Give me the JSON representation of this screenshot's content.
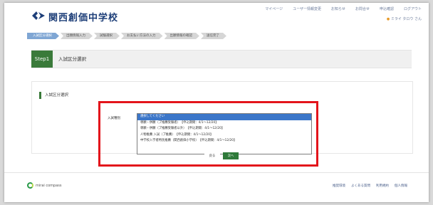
{
  "header": {
    "school_name": "関西創価中学校",
    "top_links": [
      "マイページ",
      "ユーザー情報変更",
      "お知らせ",
      "お問合せ",
      "申込確認",
      "ログアウト"
    ],
    "user_name": "ミライ タロウ さん"
  },
  "steps": [
    {
      "label": "入試区分選択",
      "active": true
    },
    {
      "label": "出願情報入力",
      "active": false
    },
    {
      "label": "試験選択",
      "active": false
    },
    {
      "label": "お支払い方法の入力",
      "active": false
    },
    {
      "label": "出願情報の確認",
      "active": false
    },
    {
      "label": "送信完了",
      "active": false
    }
  ],
  "step_header": {
    "badge": "Step1",
    "title": "入試区分選択"
  },
  "section": {
    "title": "入試区分選択"
  },
  "form": {
    "exam_label": "入試種別",
    "options": [
      "選択してください",
      "専願・併願（プ推薦受験者）　【申込期間：4/1〜12/20】",
      "専願・併願（プ推薦受験者以外）　【申込期間：4/1〜12/20】",
      "人物推薦 入試（プ推薦）　【申込期間：4/1〜12/20】",
      "中学校入学者特別推薦（関西創価小学校）　【申込期間：4/1〜12/20】"
    ],
    "selected_index": 0,
    "back_label": "戻る",
    "next_label": "次へ"
  },
  "footer": {
    "logo_text": "mirai compass",
    "links": [
      "推奨環境",
      "よくある質問",
      "利用規約",
      "個人情報"
    ]
  },
  "colors": {
    "highlight": "#e3141b",
    "accent_green": "#3a7a3a",
    "selection_blue": "#3b76c9",
    "active_step": "#7fa6d4"
  }
}
